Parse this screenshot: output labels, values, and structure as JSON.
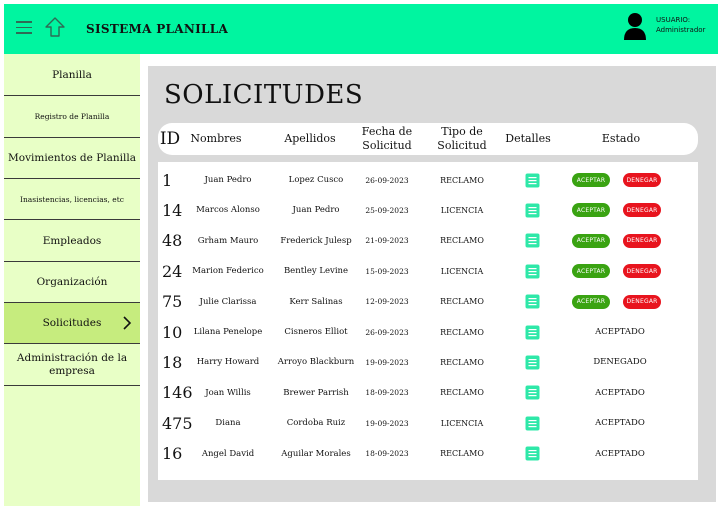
{
  "header": {
    "title": "SISTEMA PLANILLA",
    "user_label": "USUARIO:",
    "user_name": "Administrador"
  },
  "sidebar": {
    "items": [
      {
        "label": "Planilla"
      },
      {
        "label": "Registro de Planilla"
      },
      {
        "label": "Movimientos de Planilla"
      },
      {
        "label": "Inasistencias, licencias, etc"
      },
      {
        "label": "Empleados"
      },
      {
        "label": "Organización"
      },
      {
        "label": "Solicitudes"
      },
      {
        "label": "Administración de la empresa"
      }
    ]
  },
  "main": {
    "title": "SOLICITUDES",
    "columns": {
      "id": "ID",
      "nombres": "Nombres",
      "apellidos": "Apellidos",
      "fecha": "Fecha de Solicitud",
      "tipo": "Tipo de Solicitud",
      "detalles": "Detalles",
      "estado": "Estado"
    },
    "actions": {
      "accept": "ACEPTAR",
      "deny": "DENEGAR"
    },
    "rows": [
      {
        "id": "1",
        "nombres": "Juan Pedro",
        "apellidos": "Lopez Cusco",
        "fecha": "26-09-2023",
        "tipo": "RECLAMO",
        "estado": ""
      },
      {
        "id": "14",
        "nombres": "Marcos Alonso",
        "apellidos": "Juan Pedro",
        "fecha": "25-09-2023",
        "tipo": "LICENCIA",
        "estado": ""
      },
      {
        "id": "48",
        "nombres": "Grham Mauro",
        "apellidos": "Frederick Julesp",
        "fecha": "21-09-2023",
        "tipo": "RECLAMO",
        "estado": ""
      },
      {
        "id": "24",
        "nombres": "Marion Federico",
        "apellidos": "Bentley Levine",
        "fecha": "15-09-2023",
        "tipo": "LICENCIA",
        "estado": ""
      },
      {
        "id": "75",
        "nombres": "Julie Clarissa",
        "apellidos": "Kerr Salinas",
        "fecha": "12-09-2023",
        "tipo": "RECLAMO",
        "estado": ""
      },
      {
        "id": "10",
        "nombres": "Lilana Penelope",
        "apellidos": "Cisneros Elliot",
        "fecha": "26-09-2023",
        "tipo": "RECLAMO",
        "estado": "ACEPTADO"
      },
      {
        "id": "18",
        "nombres": "Harry Howard",
        "apellidos": "Arroyo Blackburn",
        "fecha": "19-09-2023",
        "tipo": "RECLAMO",
        "estado": "DENEGADO"
      },
      {
        "id": "146",
        "nombres": "Joan Willis",
        "apellidos": "Brewer Parrish",
        "fecha": "18-09-2023",
        "tipo": "RECLAMO",
        "estado": "ACEPTADO"
      },
      {
        "id": "475",
        "nombres": "Diana",
        "apellidos": "Cordoba Ruiz",
        "fecha": "19-09-2023",
        "tipo": "LICENCIA",
        "estado": "ACEPTADO"
      },
      {
        "id": "16",
        "nombres": "Angel David",
        "apellidos": "Aguilar Morales",
        "fecha": "18-09-2023",
        "tipo": "RECLAMO",
        "estado": "ACEPTADO"
      }
    ]
  },
  "colors": {
    "topbar": "#00f5a0",
    "sidebar": "#e8ffc6",
    "sidebar_active": "#c6ec7e",
    "main_bg": "#d9d9d9",
    "accept": "#3aa312",
    "deny": "#e8141e",
    "doc_icon": "#2ee8a8"
  },
  "icons": {
    "menu": "hamburger-icon",
    "up": "up-arrow-icon",
    "user": "user-icon",
    "chevron": "chevron-right-icon",
    "details": "document-icon"
  }
}
